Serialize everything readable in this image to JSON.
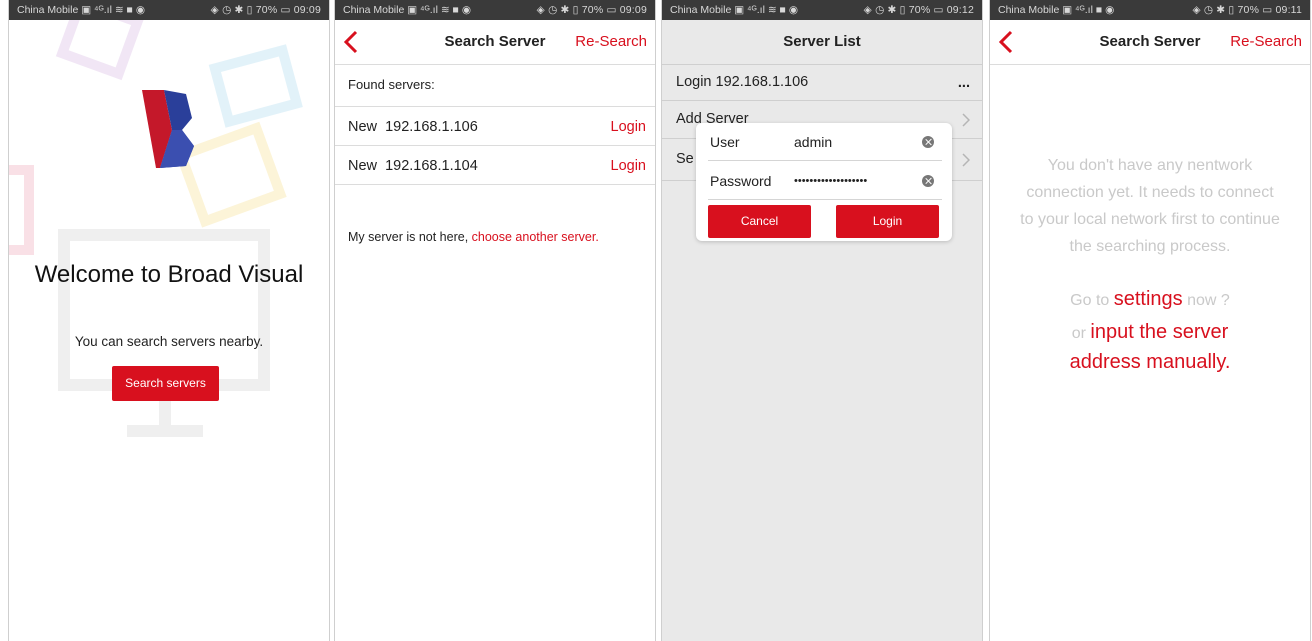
{
  "screens": [
    {
      "status": {
        "carrier": "China Mobile ▣ ⁴ᴳ.ıl ≋ ■ ◉",
        "right": "◈ ◷ ✱ ▯ 70% ▭ 09:09"
      },
      "welcome_title": "Welcome to Broad Visual",
      "subtitle": "You can search servers nearby.",
      "search_button": "Search servers",
      "logo_icon": "broad-visual-logo"
    },
    {
      "status": {
        "carrier": "China Mobile ▣ ⁴ᴳ.ıl ≋ ■ ◉",
        "right": "◈ ◷ ✱ ▯ 70% ▭ 09:09"
      },
      "nav": {
        "title": "Search Server",
        "action": "Re-Search",
        "back_icon": "chevron-left-icon"
      },
      "found_label": "Found servers:",
      "servers": [
        {
          "tag": "New",
          "ip": "192.168.1.106",
          "action": "Login"
        },
        {
          "tag": "New",
          "ip": "192.168.1.104",
          "action": "Login"
        }
      ],
      "not_here": "My server is not here, ",
      "choose_link": "choose another server."
    },
    {
      "status": {
        "carrier": "China Mobile ▣ ⁴ᴳ.ıl ≋ ■ ◉",
        "right": "◈ ◷ ✱ ▯ 70% ▭ 09:12"
      },
      "nav": {
        "title": "Server List"
      },
      "rows": [
        {
          "label": "Login 192.168.1.106",
          "more": "..."
        },
        {
          "label": "Add Server"
        },
        {
          "label": "Se"
        }
      ],
      "dialog": {
        "user_label": "User",
        "user_value": "admin",
        "password_label": "Password",
        "password_value": "•••••••••••••••••••",
        "cancel": "Cancel",
        "login": "Login"
      }
    },
    {
      "status": {
        "carrier": "China Mobile ▣ ⁴ᴳ.ıl ■ ◉",
        "right": "◈ ◷ ✱ ▯ 70% ▭ 09:11"
      },
      "nav": {
        "title": "Search Server",
        "action": "Re-Search"
      },
      "message": "You don't have any nentwork connection yet. It needs to connect to your local network first to continue the searching process.",
      "go_to": "Go to ",
      "settings_link": "settings",
      "now": " now ?",
      "or": "or ",
      "manual_link": "input the server address manually."
    }
  ],
  "colors": {
    "accent": "#d8101e",
    "status_bar": "#3a3a3a",
    "muted_text": "#c9c9c9"
  }
}
